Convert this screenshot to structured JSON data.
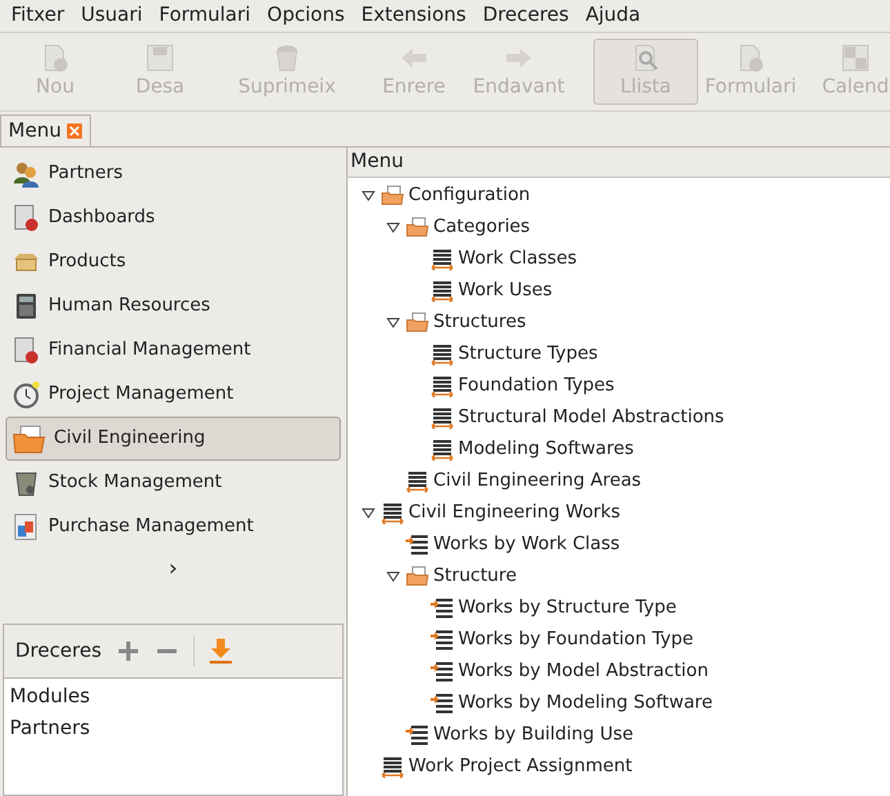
{
  "menu_bar": [
    "Fitxer",
    "Usuari",
    "Formulari",
    "Opcions",
    "Extensions",
    "Dreceres",
    "Ajuda"
  ],
  "toolbar": [
    {
      "kind": "button",
      "label": "Nou",
      "disabled": true,
      "selected": false
    },
    {
      "kind": "button",
      "label": "Desa",
      "disabled": true,
      "selected": false
    },
    {
      "kind": "separator"
    },
    {
      "kind": "button",
      "label": "Suprimeix",
      "disabled": true,
      "selected": false
    },
    {
      "kind": "separator"
    },
    {
      "kind": "button",
      "label": "Enrere",
      "disabled": true,
      "selected": false
    },
    {
      "kind": "button",
      "label": "Endavant",
      "disabled": true,
      "selected": false
    },
    {
      "kind": "separator"
    },
    {
      "kind": "button",
      "label": "Llista",
      "disabled": true,
      "selected": true
    },
    {
      "kind": "button",
      "label": "Formulari",
      "disabled": true,
      "selected": false
    },
    {
      "kind": "button",
      "label": "Calend",
      "disabled": true,
      "selected": false
    }
  ],
  "tabs": [
    {
      "label": "Menu",
      "selected": true
    }
  ],
  "modules": [
    {
      "label": "Partners",
      "selected": false
    },
    {
      "label": "Dashboards",
      "selected": false
    },
    {
      "label": "Products",
      "selected": false
    },
    {
      "label": "Human Resources",
      "selected": false
    },
    {
      "label": "Financial Management",
      "selected": false
    },
    {
      "label": "Project Management",
      "selected": false
    },
    {
      "label": "Civil Engineering",
      "selected": true
    },
    {
      "label": "Stock Management",
      "selected": false
    },
    {
      "label": "Purchase Management",
      "selected": false
    }
  ],
  "more_glyph": "›",
  "shortcuts": {
    "title": "Dreceres",
    "items": [
      "Modules",
      "Partners"
    ]
  },
  "tree": {
    "header": "Menu",
    "items": [
      {
        "label": "Configuration",
        "kind": "folder",
        "expanded": true,
        "children": [
          {
            "label": "Categories",
            "kind": "folder",
            "expanded": true,
            "children": [
              {
                "label": "Work Classes",
                "kind": "table"
              },
              {
                "label": "Work Uses",
                "kind": "table"
              }
            ]
          },
          {
            "label": "Structures",
            "kind": "folder",
            "expanded": true,
            "children": [
              {
                "label": "Structure Types",
                "kind": "table"
              },
              {
                "label": "Foundation Types",
                "kind": "table"
              },
              {
                "label": "Structural Model Abstractions",
                "kind": "table"
              },
              {
                "label": "Modeling Softwares",
                "kind": "table"
              }
            ]
          },
          {
            "label": "Civil Engineering Areas",
            "kind": "table"
          }
        ]
      },
      {
        "label": "Civil Engineering Works",
        "kind": "table",
        "expanded": true,
        "children": [
          {
            "label": "Works by Work Class",
            "kind": "action"
          },
          {
            "label": "Structure",
            "kind": "folder",
            "expanded": true,
            "children": [
              {
                "label": "Works by Structure Type",
                "kind": "action"
              },
              {
                "label": "Works by Foundation Type",
                "kind": "action"
              },
              {
                "label": "Works by Model Abstraction",
                "kind": "action"
              },
              {
                "label": "Works by Modeling Software",
                "kind": "action"
              }
            ]
          },
          {
            "label": "Works by Building Use",
            "kind": "action"
          }
        ]
      },
      {
        "label": "Work Project Assignment",
        "kind": "table"
      }
    ]
  }
}
